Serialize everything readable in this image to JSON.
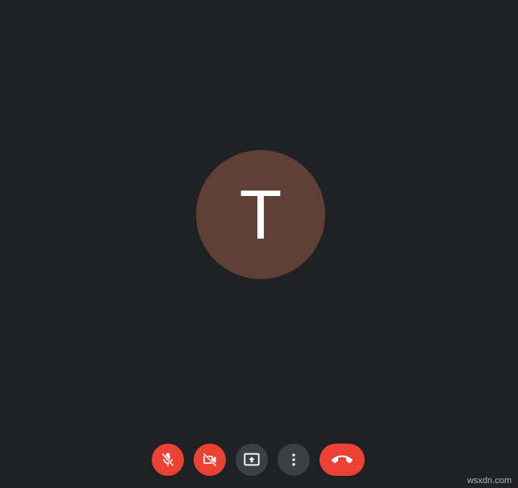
{
  "avatar": {
    "initial": "T",
    "color": "#5f4037"
  },
  "controls": {
    "mic": {
      "icon": "mic-off-icon",
      "state": "off",
      "color": "#ea4335"
    },
    "camera": {
      "icon": "videocam-off-icon",
      "state": "off",
      "color": "#ea4335"
    },
    "present": {
      "icon": "present-screen-icon",
      "color": "#3c4043"
    },
    "more": {
      "icon": "more-vert-icon",
      "color": "#3c4043"
    },
    "leave": {
      "icon": "call-end-icon",
      "color": "#ea4335"
    }
  },
  "watermark": "wsxdn.com"
}
